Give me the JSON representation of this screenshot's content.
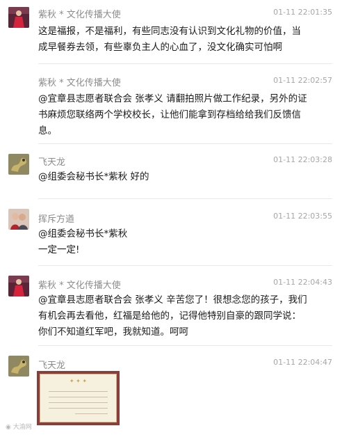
{
  "messages": [
    {
      "name": "紫秋 * 文化传播大使",
      "time": "01-11 22:01:35",
      "avatar": "avatar-red-dress",
      "lines": [
        "这是福报，不是福利，有些同志没有认识到文化礼物的价值，当",
        "成早餐券去领，有些辜负主人的心血了，没文化确实可怕啊"
      ]
    },
    {
      "name": "紫秋 * 文化传播大使",
      "time": "01-11 22:02:57",
      "avatar": "",
      "lines": [
        "@宜章县志愿者联合会 张孝义 请翻拍照片做工作纪录，另外的证",
        "书麻烦您联络两个学校校长，让他们能拿到存档给给我们反馈信",
        "息。"
      ]
    },
    {
      "name": "飞天龙",
      "time": "01-11 22:03:28",
      "avatar": "avatar-dragon",
      "lines": [
        "@组委会秘书长*紫秋 好的"
      ]
    },
    {
      "name": "挥斥方遒",
      "time": "01-11 22:03:55",
      "avatar": "avatar-couple",
      "lines": [
        "@组委会秘书长*紫秋",
        "一定一定!"
      ]
    },
    {
      "name": "紫秋 * 文化传播大使",
      "time": "01-11 22:04:43",
      "avatar": "avatar-red-dress",
      "lines": [
        "@宜章县志愿者联合会 张孝义 辛苦您了！很想念您的孩子，我们",
        "有机会再去看他，红福是给他的，记得他特别自豪的跟同学说：",
        "你们不知道红军吧，我就知道。呵呵"
      ]
    },
    {
      "name": "飞天龙",
      "time": "01-11 22:04:47",
      "avatar": "avatar-dragon",
      "lines": []
    }
  ],
  "watermark": "大渝网"
}
